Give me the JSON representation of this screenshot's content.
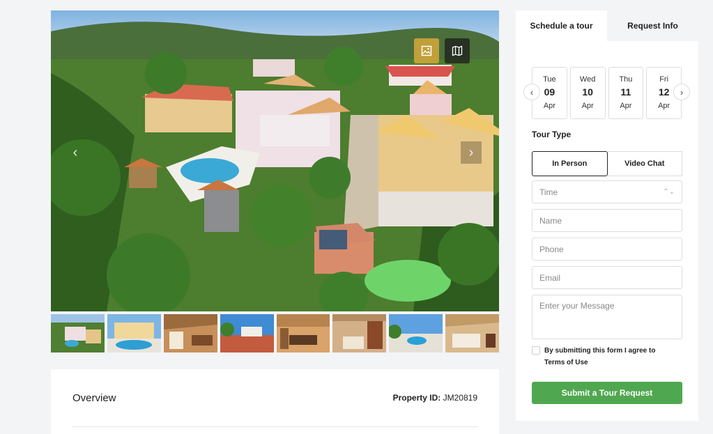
{
  "gallery": {
    "photo_button_icon": "image-icon",
    "map_button_icon": "map-icon",
    "thumbnails": [
      "aerial-villa",
      "pool-courtyard",
      "living-room",
      "exterior-drive",
      "dining-room",
      "kitchen",
      "pool-deck",
      "bedroom"
    ]
  },
  "overview": {
    "title": "Overview",
    "property_id_label": "Property ID:",
    "property_id_value": "JM20819"
  },
  "tour": {
    "tabs": [
      "Schedule a tour",
      "Request Info"
    ],
    "dates": [
      {
        "dow": "Tue",
        "dom": "09",
        "mon": "Apr"
      },
      {
        "dow": "Wed",
        "dom": "10",
        "mon": "Apr"
      },
      {
        "dow": "Thu",
        "dom": "11",
        "mon": "Apr"
      },
      {
        "dow": "Fri",
        "dom": "12",
        "mon": "Apr"
      }
    ],
    "tour_type_label": "Tour Type",
    "tour_types": [
      "In Person",
      "Video Chat"
    ],
    "time_placeholder": "Time",
    "name_placeholder": "Name",
    "phone_placeholder": "Phone",
    "email_placeholder": "Email",
    "message_placeholder": "Enter your Message",
    "consent_line1": "By submitting this form I agree to",
    "consent_line2": "Terms of Use",
    "submit_label": "Submit a Tour Request"
  },
  "colors": {
    "submit": "#4fa84f",
    "photo_button": "#d6a83a",
    "page_bg": "#f3f4f6"
  }
}
